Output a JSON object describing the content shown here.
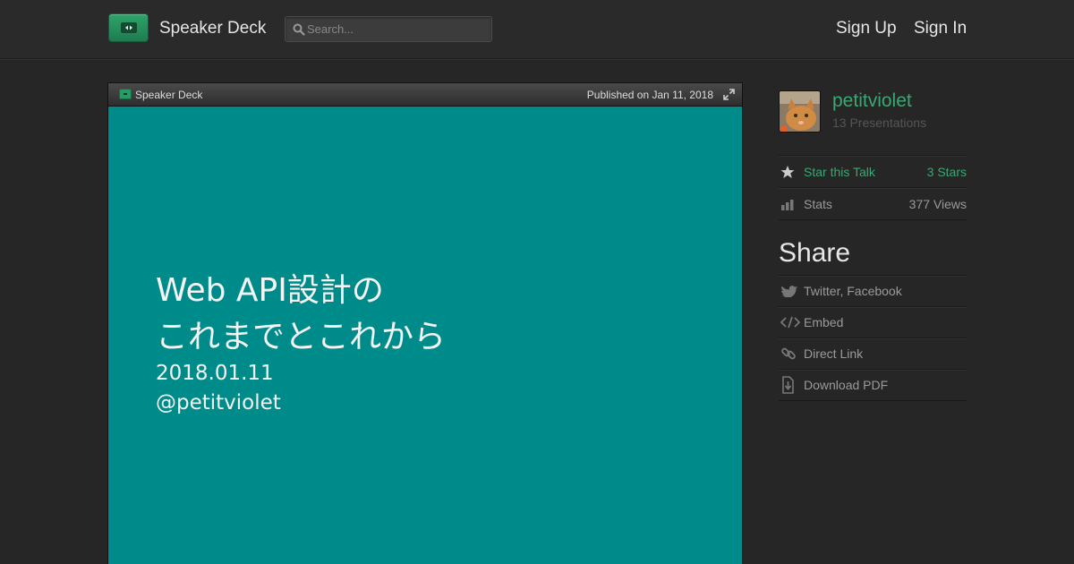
{
  "header": {
    "brand": "Speaker Deck",
    "search_placeholder": "Search...",
    "sign_up": "Sign Up",
    "sign_in": "Sign In"
  },
  "player": {
    "brand": "Speaker Deck",
    "published": "Published on Jan 11, 2018",
    "slide": {
      "title_line1": "Web API設計の",
      "title_line2": "これまでとこれから",
      "date": "2018.01.11",
      "author": "@petitviolet"
    }
  },
  "sidebar": {
    "author_name": "petitviolet",
    "presentations": "13 Presentations",
    "star_label": "Star this Talk",
    "star_count": "3 Stars",
    "stats_label": "Stats",
    "stats_views": "377 Views",
    "share_heading": "Share",
    "share_items": [
      {
        "label": "Twitter, Facebook",
        "icon": "twitter-bird-icon"
      },
      {
        "label": "Embed",
        "icon": "code-icon"
      },
      {
        "label": "Direct Link",
        "icon": "link-icon"
      },
      {
        "label": "Download PDF",
        "icon": "download-icon"
      }
    ]
  },
  "colors": {
    "accent": "#3aa872",
    "slide_bg": "#008b8b",
    "page_bg": "#262626"
  }
}
